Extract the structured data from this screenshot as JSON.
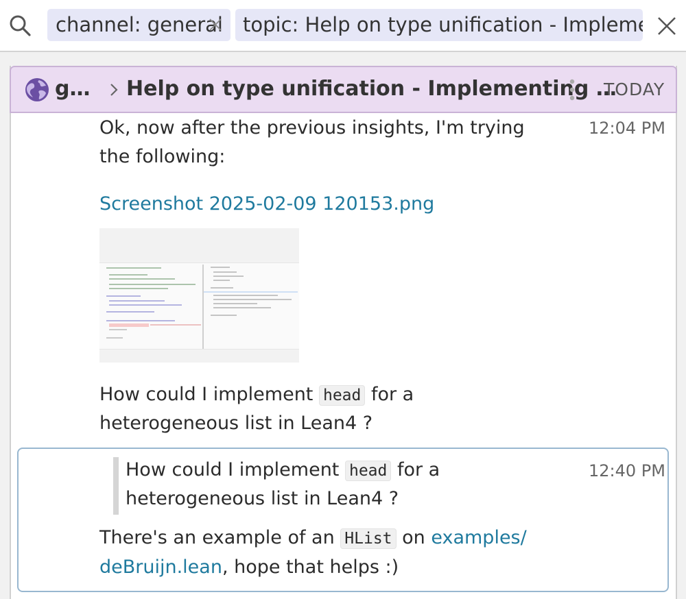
{
  "search": {
    "filters": [
      {
        "label": "channel: general"
      },
      {
        "label": "topic: Help on type unification - Implementing"
      }
    ]
  },
  "recipient_bar": {
    "stream": "g…",
    "topic": "Help on type unification - Implementing …",
    "date": "TODAY"
  },
  "messages": [
    {
      "time": "12:04 PM",
      "text_line1": "Ok, now after the previous insights, I'm trying",
      "text_line2": "the following:",
      "attachment_name": "Screenshot 2025-02-09 120153.png",
      "question_line1_pre": "How could I implement ",
      "question_code": "head",
      "question_line1_post": " for a",
      "question_line2": "heterogeneous list in Lean4 ?"
    },
    {
      "time": "12:40 PM",
      "quote_line1_pre": "How could I implement ",
      "quote_code": "head",
      "quote_line1_post": " for a",
      "quote_line2": "heterogeneous list in Lean4 ?",
      "reply_pre": "There's an example of an ",
      "reply_code": "HList",
      "reply_mid": " on ",
      "reply_link_line1": "examples/",
      "reply_link_line2": "deBruijn.lean",
      "reply_post": ", hope that helps :)"
    }
  ],
  "colors": {
    "recipient_bg": "#ebdcf2",
    "pill_bg": "#e6e7f7",
    "link": "#1f7a9e",
    "reply_border": "#98b7d0"
  }
}
